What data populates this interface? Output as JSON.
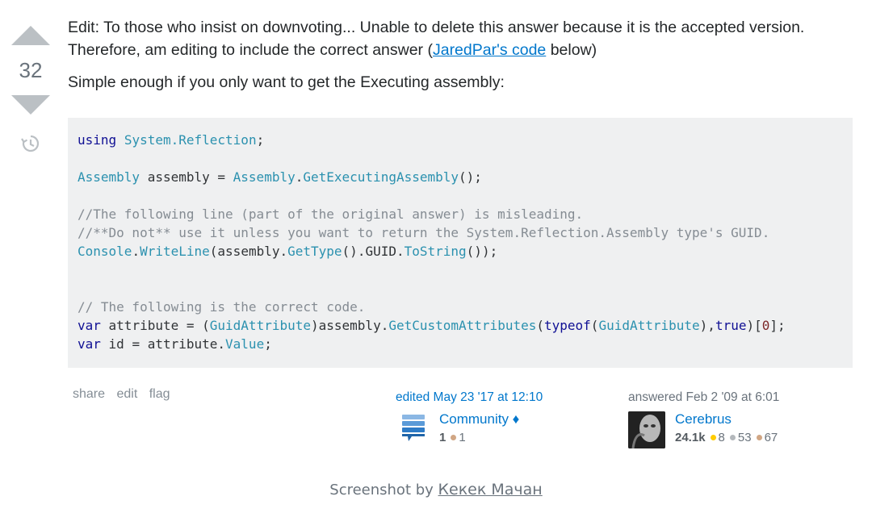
{
  "vote": {
    "score": "32"
  },
  "post": {
    "edit_note_prefix": "Edit: To those who insist on downvoting... Unable to delete this answer because it is the accepted version. Therefore, am editing to include the correct answer (",
    "edit_note_link": "JaredPar's code",
    "edit_note_suffix": " below)",
    "intro": "Simple enough if you only want to get the Executing assembly:"
  },
  "code": {
    "line1": [
      "using",
      "System.Reflection",
      ";"
    ],
    "line2": [
      "Assembly",
      " assembly = ",
      "Assembly",
      ".",
      "GetExecutingAssembly",
      "();"
    ],
    "comment1": "//The following line (part of the original answer) is misleading.",
    "comment2": "//**Do not** use it unless you want to return the System.Reflection.Assembly type's GUID.",
    "line5": [
      "Console",
      ".",
      "WriteLine",
      "(assembly.",
      "GetType",
      "().GUID.",
      "ToString",
      "());"
    ],
    "comment3": "// The following is the correct code.",
    "line7": [
      "var",
      " attribute = (",
      "GuidAttribute",
      ")assembly.",
      "GetCustomAttributes",
      "(",
      "typeof",
      "(",
      "GuidAttribute",
      "),",
      "true",
      ")[",
      "0",
      "];"
    ],
    "line8": [
      "var",
      " id = attribute.",
      "Value",
      ";"
    ]
  },
  "menu": {
    "share": "share",
    "edit": "edit",
    "flag": "flag"
  },
  "editor": {
    "action": "edited May 23 '17 at 12:10",
    "name": "Community ♦",
    "rep": "1",
    "bronze": "1",
    "icon": "community-stack-icon"
  },
  "owner": {
    "action": "answered Feb 2 '09 at 6:01",
    "name": "Cerebrus",
    "rep": "24.1k",
    "gold": "8",
    "silver": "53",
    "bronze": "67"
  },
  "footer": {
    "prefix": "Screenshot by ",
    "author": "Кекек Мачан"
  },
  "colors": {
    "link": "#0077cc",
    "code_bg": "#eff0f1",
    "gold": "#ffcc01",
    "silver": "#b4b8bc",
    "bronze": "#d1a684"
  }
}
